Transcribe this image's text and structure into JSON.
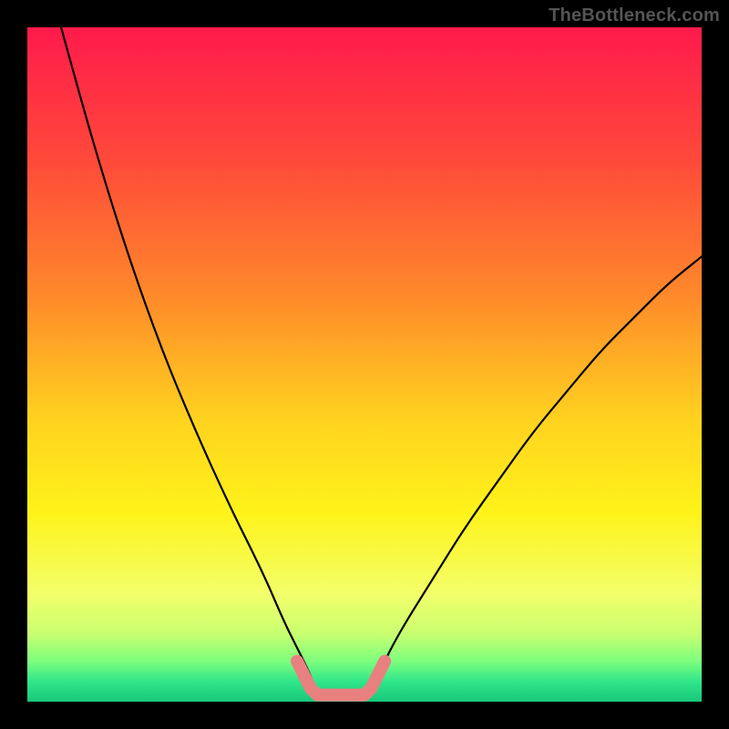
{
  "watermark": "TheBottleneck.com",
  "chart_data": {
    "type": "line",
    "title": "",
    "xlabel": "",
    "ylabel": "",
    "xlim": [
      0,
      100
    ],
    "ylim": [
      0,
      100
    ],
    "grid": false,
    "legend": false,
    "annotations": [],
    "series": [
      {
        "name": "left-curve",
        "x": [
          5,
          10,
          15,
          20,
          25,
          30,
          35,
          38,
          40,
          42,
          43
        ],
        "y": [
          100,
          82,
          66,
          52,
          40,
          29,
          19,
          12,
          8,
          4,
          1
        ]
      },
      {
        "name": "right-curve",
        "x": [
          50,
          52,
          55,
          60,
          65,
          70,
          75,
          80,
          85,
          90,
          95,
          100
        ],
        "y": [
          1,
          4,
          10,
          18,
          26,
          33,
          40,
          46,
          52,
          57,
          62,
          66
        ]
      },
      {
        "name": "floor-marker",
        "x": [
          40,
          41,
          42,
          43,
          44,
          46,
          48,
          50,
          51,
          52,
          53
        ],
        "y": [
          6,
          4,
          2,
          1,
          1,
          1,
          1,
          1,
          2,
          4,
          6
        ]
      }
    ],
    "gradient_stops": [
      {
        "offset": 0.0,
        "color": "#ff1a4b"
      },
      {
        "offset": 0.2,
        "color": "#ff4a3a"
      },
      {
        "offset": 0.4,
        "color": "#ff8a2a"
      },
      {
        "offset": 0.58,
        "color": "#ffd21f"
      },
      {
        "offset": 0.72,
        "color": "#fff31a"
      },
      {
        "offset": 0.84,
        "color": "#f3ff6a"
      },
      {
        "offset": 0.9,
        "color": "#c8ff70"
      },
      {
        "offset": 0.94,
        "color": "#7dff7d"
      },
      {
        "offset": 0.97,
        "color": "#30e68a"
      },
      {
        "offset": 1.0,
        "color": "#18c87a"
      }
    ],
    "colors": {
      "curve": "#000000",
      "marker": "#e98080"
    }
  }
}
